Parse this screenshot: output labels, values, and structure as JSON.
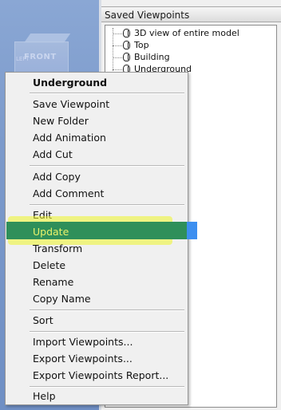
{
  "viewport": {
    "viewcube_label": "FRONT",
    "viewcube_side_label": "LEFT"
  },
  "panel": {
    "title": "Saved Viewpoints",
    "items": [
      {
        "label": "3D view of entire model"
      },
      {
        "label": "Top"
      },
      {
        "label": "Building"
      },
      {
        "label": "Underground"
      }
    ]
  },
  "menu": {
    "title": "Underground",
    "items": [
      "Save Viewpoint",
      "New Folder",
      "Add Animation",
      "Add Cut",
      "Add Copy",
      "Add Comment",
      "Edit",
      "Update",
      "Transform",
      "Delete",
      "Rename",
      "Copy Name",
      "Sort",
      "Import Viewpoints...",
      "Export Viewpoints...",
      "Export Viewpoints Report...",
      "Help"
    ],
    "highlighted": "Update"
  },
  "colors": {
    "viewport_bg": "#7c9acb",
    "highlight_bg": "#2f8f5a",
    "highlight_text": "#e9f26a",
    "annotation": "#eef628"
  }
}
